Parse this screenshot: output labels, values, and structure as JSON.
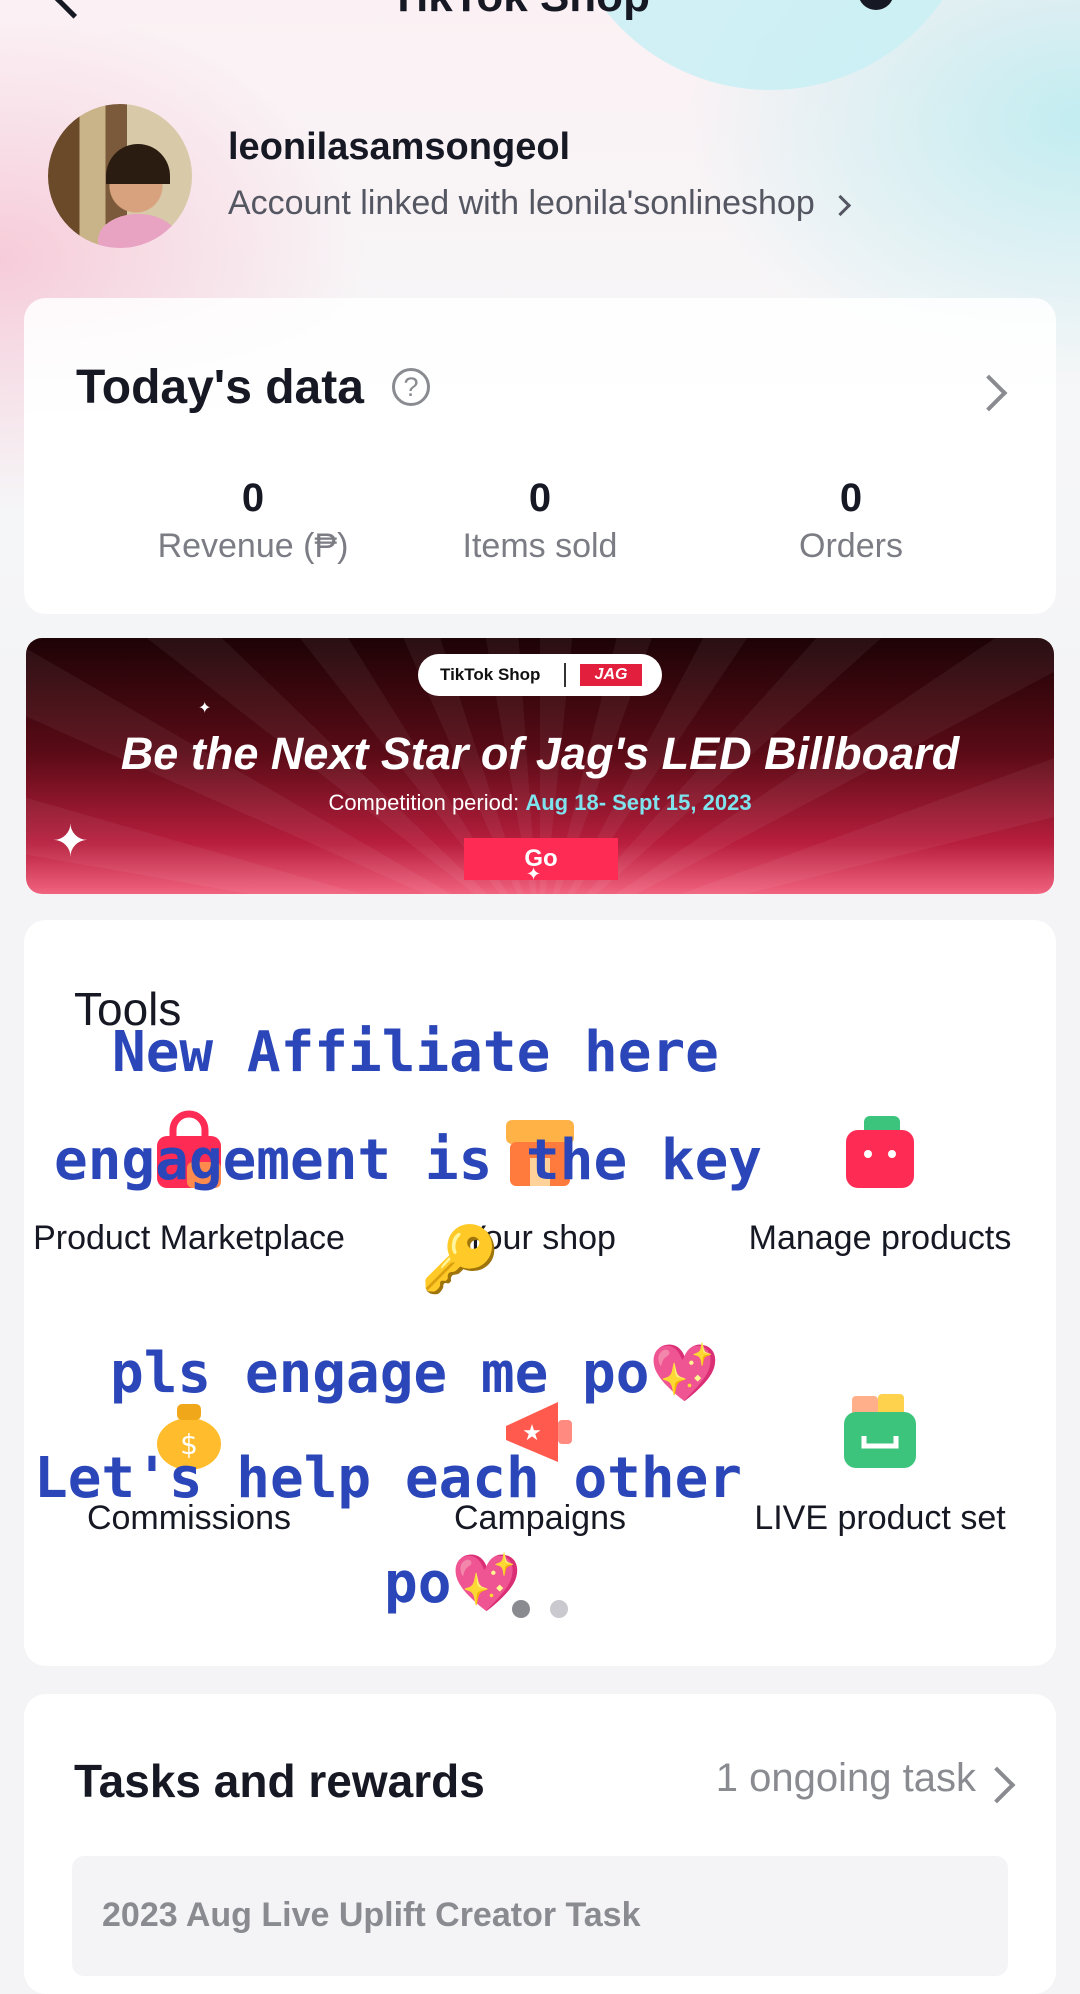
{
  "topbar": {
    "title": "TikTok Shop"
  },
  "profile": {
    "username": "leonilasamsongeol",
    "linked_text": "Account linked with leonila'sonlineshop"
  },
  "today": {
    "title": "Today's data",
    "help": "?",
    "stats": [
      {
        "value": "0",
        "label": "Revenue (₱)"
      },
      {
        "value": "0",
        "label": "Items sold"
      },
      {
        "value": "0",
        "label": "Orders"
      }
    ]
  },
  "banner": {
    "brand": "TikTok Shop",
    "partner": "JAG",
    "title": "Be the Next Star of Jag's LED Billboard",
    "period_label": "Competition period:",
    "period_dates": "Aug 18- Sept 15, 2023",
    "cta": "Go"
  },
  "tools": {
    "title": "Tools",
    "items": [
      {
        "label": "Product Marketplace",
        "icon": "shopping-bag-icon",
        "color": "#fe2c55"
      },
      {
        "label": "Your shop",
        "icon": "storefront-icon",
        "color": "#ff7a3d"
      },
      {
        "label": "Manage products",
        "icon": "box-icon",
        "color": "#fe2c55"
      },
      {
        "label": "Commissions",
        "icon": "money-bag-icon",
        "color": "#ffbd2e"
      },
      {
        "label": "Campaigns",
        "icon": "megaphone-icon",
        "color": "#ff5a4d"
      },
      {
        "label": "LIVE product set",
        "icon": "cart-icon",
        "color": "#3cc47c"
      }
    ],
    "pagination": {
      "pages": 2,
      "active": 1
    }
  },
  "tasks": {
    "title": "Tasks and rewards",
    "ongoing": "1 ongoing task",
    "item_title": "2023 Aug Live Uplift Creator Task"
  },
  "overlay": {
    "line1": "New Affiliate here",
    "line2": "engagement is the key",
    "line3": "pls engage me po",
    "line4": "Let's help each other",
    "line5": "po",
    "heart": "💖",
    "key": "🔑"
  }
}
